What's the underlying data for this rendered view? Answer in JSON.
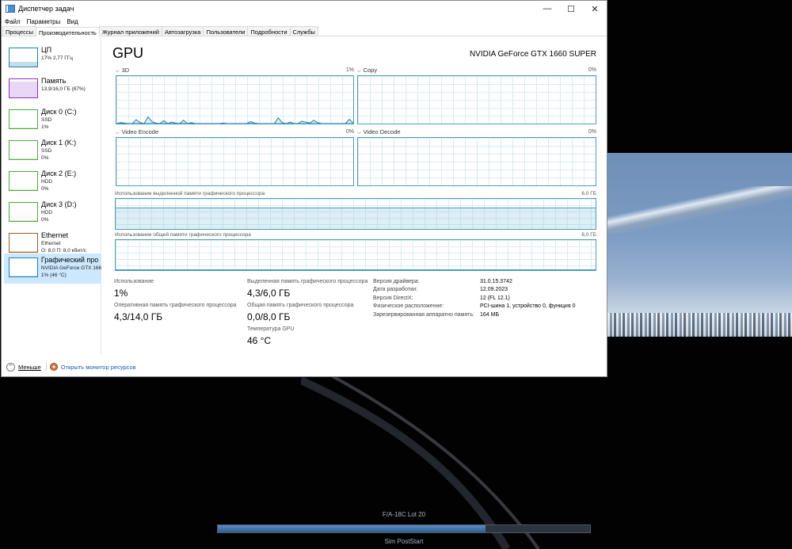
{
  "window": {
    "title": "Диспетчер задач",
    "controls": {
      "minimize": "—",
      "maximize": "☐",
      "close": "✕"
    }
  },
  "menu": [
    "Файл",
    "Параметры",
    "Вид"
  ],
  "tabs": [
    "Процессы",
    "Производительность",
    "Журнал приложений",
    "Автозагрузка",
    "Пользователи",
    "Подробности",
    "Службы"
  ],
  "active_tab": "Производительность",
  "sidebar": [
    {
      "name": "ЦП",
      "line1": "17% 2,77 ГГц",
      "line2": "",
      "color": "#1a7fb8"
    },
    {
      "name": "Память",
      "line1": "13,9/16,0 ГБ (87%)",
      "line2": "",
      "color": "#8b2fc9"
    },
    {
      "name": "Диск 0 (C:)",
      "line1": "SSD",
      "line2": "1%",
      "color": "#4da93a"
    },
    {
      "name": "Диск 1 (K:)",
      "line1": "SSD",
      "line2": "0%",
      "color": "#4da93a"
    },
    {
      "name": "Диск 2 (E:)",
      "line1": "HDD",
      "line2": "0%",
      "color": "#4da93a"
    },
    {
      "name": "Диск 3 (D:)",
      "line1": "HDD",
      "line2": "0%",
      "color": "#4da93a"
    },
    {
      "name": "Ethernet",
      "line1": "Ethernet",
      "line2": "О: 8,0 П: 8,0 кбит/с",
      "color": "#a7591a"
    },
    {
      "name": "Графический про",
      "line1": "NVIDIA GeForce GTX 166",
      "line2": "1% (46 °C)",
      "color": "#1a7fb8"
    }
  ],
  "gpu": {
    "title": "GPU",
    "model": "NVIDIA GeForce GTX 1660 SUPER",
    "engines": [
      {
        "label": "3D",
        "value": "1%"
      },
      {
        "label": "Copy",
        "value": "0%"
      },
      {
        "label": "Video Encode",
        "value": "0%"
      },
      {
        "label": "Video Decode",
        "value": "0%"
      }
    ],
    "dedicated_label": "Использование выделенной памяти графического процессора",
    "dedicated_max": "6,0 ГБ",
    "dedicated_used_fraction": 0.72,
    "shared_label": "Использование общей памяти графического процессора",
    "shared_max": "8,0 ГБ",
    "shared_used_fraction": 0.0,
    "stats": {
      "usage_label": "Использование",
      "usage": "1%",
      "ram_label": "Оперативная память графического процессора",
      "ram": "4,3/14,0 ГБ",
      "dedicated_label": "Выделенная память графического процессора",
      "dedicated": "4,3/6,0 ГБ",
      "shared_label": "Общая память графического процессора",
      "shared": "0,0/8,0 ГБ",
      "temp_label": "Температура GPU",
      "temp": "46 °C"
    },
    "info": [
      {
        "key": "Версия драйвера:",
        "value": "31.0.15.3742"
      },
      {
        "key": "Дата разработки:",
        "value": "12.09.2023"
      },
      {
        "key": "Версия DirectX:",
        "value": "12 (FL 12.1)"
      },
      {
        "key": "Физическое расположение:",
        "value": "PCI-шина 1, устройство 0, функция 0"
      },
      {
        "key": "Зарезервированная аппаратно память:",
        "value": "164 МБ"
      }
    ],
    "spark_3d": [
      0,
      2,
      1,
      0,
      0,
      8,
      2,
      0,
      14,
      4,
      1,
      0,
      6,
      0,
      3,
      1,
      0,
      7,
      0,
      2,
      0,
      0,
      0,
      0,
      0,
      0,
      0,
      1,
      0,
      0,
      0,
      0,
      0,
      0,
      4,
      1,
      0,
      0,
      0,
      0,
      0,
      12,
      2,
      0,
      3,
      0,
      0,
      5,
      3,
      1,
      7,
      2,
      0,
      0,
      0,
      0,
      0,
      0,
      0,
      9,
      1
    ]
  },
  "footer": {
    "fewer": "Меньше",
    "resource_monitor": "Открыть монитор ресурсов"
  },
  "loading": {
    "title": "F/A-18C Lot 20",
    "status": "Sim PostStart",
    "progress_fraction": 0.72
  },
  "colors": {
    "accent": "#1a7fb8",
    "graph_border": "#4a9cbe",
    "selected_bg": "#cce8ff",
    "link": "#1a5bb0"
  }
}
